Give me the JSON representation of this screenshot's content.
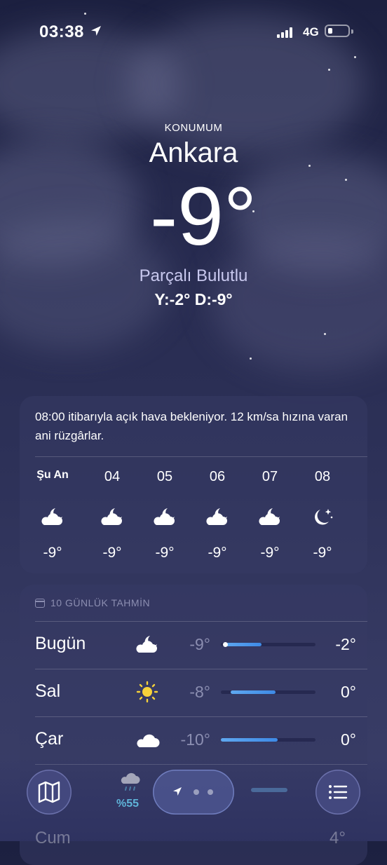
{
  "status_bar": {
    "time": "03:38",
    "network": "4G"
  },
  "header": {
    "location_label": "KONUMUM",
    "city": "Ankara",
    "temperature": "-9°",
    "condition": "Parçalı Bulutlu",
    "high_low": "Y:-2° D:-9°"
  },
  "hourly_card": {
    "summary": "08:00 itibarıyla açık hava bekleniyor. 12 km/sa hızına varan ani rüzgârlar.",
    "hours": [
      {
        "label": "Şu An",
        "icon": "partly-cloudy-night-icon",
        "temp": "-9°"
      },
      {
        "label": "04",
        "icon": "partly-cloudy-night-icon",
        "temp": "-9°"
      },
      {
        "label": "05",
        "icon": "partly-cloudy-night-icon",
        "temp": "-9°"
      },
      {
        "label": "06",
        "icon": "partly-cloudy-night-icon",
        "temp": "-9°"
      },
      {
        "label": "07",
        "icon": "partly-cloudy-night-icon",
        "temp": "-9°"
      },
      {
        "label": "08",
        "icon": "clear-night-icon",
        "temp": "-9°"
      }
    ]
  },
  "daily_card": {
    "title": "10 GÜNLÜK TAHMİN",
    "days": [
      {
        "day": "Bugün",
        "icon": "partly-cloudy-night-icon",
        "low": "-9°",
        "high": "-2°",
        "range_start": 0.03,
        "range_end": 0.43,
        "current": 0.03
      },
      {
        "day": "Sal",
        "icon": "sun-icon",
        "low": "-8°",
        "high": "0°",
        "range_start": 0.1,
        "range_end": 0.58
      },
      {
        "day": "Çar",
        "icon": "cloud-icon",
        "low": "-10°",
        "high": "0°",
        "range_start": 0.0,
        "range_end": 0.6
      }
    ]
  },
  "toolbar": {
    "partial_precip": "%55",
    "partial_day": "Cum",
    "partial_high": "4°"
  },
  "colors": {
    "accent_blue": "#3e8ae6",
    "condition_text": "#c8c8ee"
  }
}
